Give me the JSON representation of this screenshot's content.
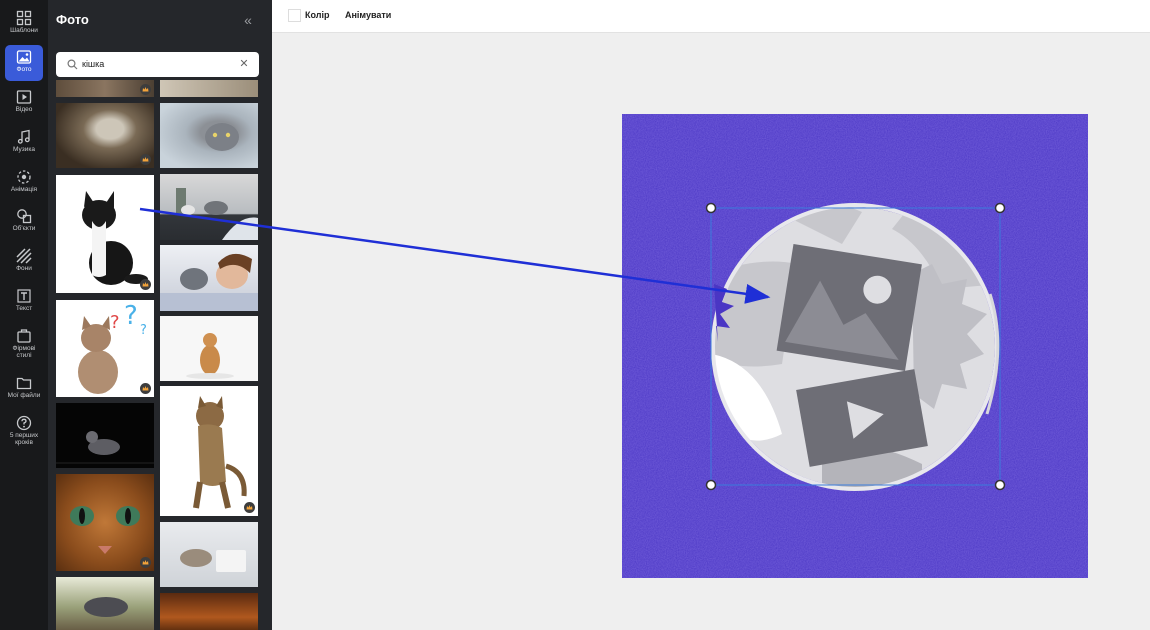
{
  "sidebar": {
    "items": [
      {
        "label": "Шаблони",
        "icon": "grid-icon"
      },
      {
        "label": "Фото",
        "icon": "image-icon",
        "active": true
      },
      {
        "label": "Відео",
        "icon": "play-icon"
      },
      {
        "label": "Музика",
        "icon": "music-note-icon"
      },
      {
        "label": "Анімація",
        "icon": "animation-icon"
      },
      {
        "label": "Об'єкти",
        "icon": "shapes-icon"
      },
      {
        "label": "Фони",
        "icon": "stripes-icon"
      },
      {
        "label": "Текст",
        "icon": "text-icon"
      },
      {
        "label": "Фірмові стилі",
        "icon": "brand-kit-icon"
      },
      {
        "label": "Мої файли",
        "icon": "folder-icon"
      },
      {
        "label": "5 перших кроків",
        "icon": "question-icon"
      }
    ]
  },
  "panel": {
    "title": "Фото",
    "search": {
      "value": "кішка",
      "placeholder": ""
    },
    "premium_badge": "crown-icon"
  },
  "toolbar": {
    "color_label": "Колір",
    "animate_label": "Анімувати"
  },
  "canvas": {
    "background_color": "#4a36c4",
    "placeholder": "media-placeholder-icon"
  },
  "colors": {
    "accent": "#3a5bd9",
    "arrow": "#1f2fd6",
    "rail_bg": "#18191b",
    "panel_bg": "#25272b"
  }
}
